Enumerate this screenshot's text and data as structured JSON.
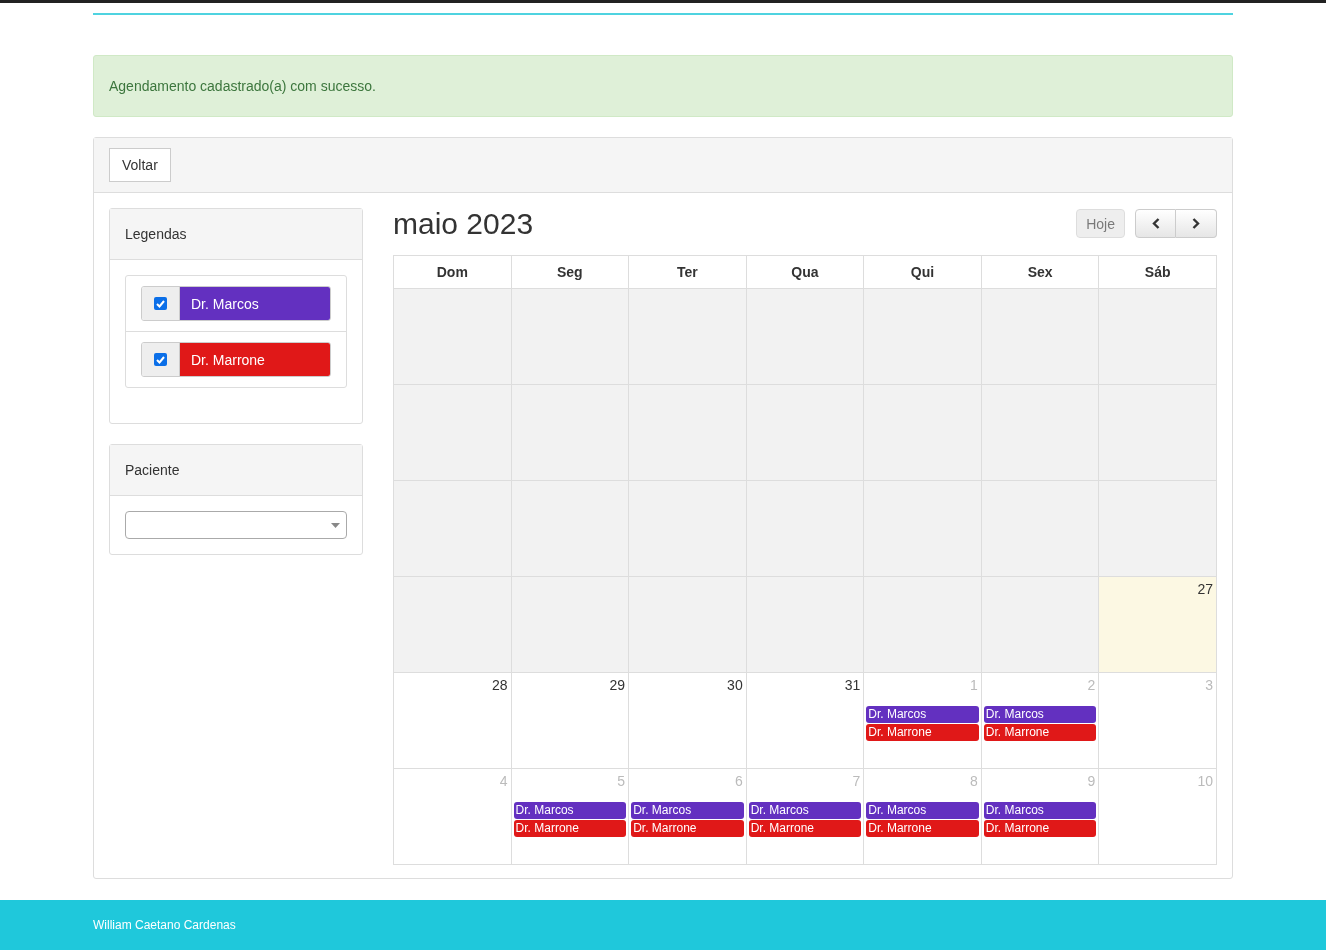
{
  "alert": {
    "message": "Agendamento cadastrado(a) com sucesso."
  },
  "toolbar": {
    "back_button": "Voltar"
  },
  "legend": {
    "title": "Legendas",
    "items": [
      {
        "label": "Dr. Marcos",
        "color": "#6330c0",
        "checked": true
      },
      {
        "label": "Dr. Marrone",
        "color": "#e01818",
        "checked": true
      }
    ]
  },
  "patient_filter": {
    "title": "Paciente"
  },
  "calendar": {
    "title": "maio 2023",
    "today_button": {
      "label": "Hoje",
      "disabled": true
    },
    "weekdays": [
      "Dom",
      "Seg",
      "Ter",
      "Qua",
      "Qui",
      "Sex",
      "Sáb"
    ],
    "weeks": [
      [
        {
          "kind": "blank"
        },
        {
          "kind": "blank"
        },
        {
          "kind": "blank"
        },
        {
          "kind": "blank"
        },
        {
          "kind": "blank"
        },
        {
          "kind": "blank"
        },
        {
          "kind": "blank"
        }
      ],
      [
        {
          "kind": "blank"
        },
        {
          "kind": "blank"
        },
        {
          "kind": "blank"
        },
        {
          "kind": "blank"
        },
        {
          "kind": "blank"
        },
        {
          "kind": "blank"
        },
        {
          "kind": "blank"
        }
      ],
      [
        {
          "kind": "blank"
        },
        {
          "kind": "blank"
        },
        {
          "kind": "blank"
        },
        {
          "kind": "blank"
        },
        {
          "kind": "blank"
        },
        {
          "kind": "blank"
        },
        {
          "kind": "blank"
        }
      ],
      [
        {
          "kind": "blank"
        },
        {
          "kind": "blank"
        },
        {
          "kind": "blank"
        },
        {
          "kind": "blank"
        },
        {
          "kind": "blank"
        },
        {
          "kind": "blank"
        },
        {
          "kind": "today",
          "day": "27"
        }
      ],
      [
        {
          "kind": "current",
          "day": "28"
        },
        {
          "kind": "current",
          "day": "29"
        },
        {
          "kind": "current",
          "day": "30"
        },
        {
          "kind": "current",
          "day": "31"
        },
        {
          "kind": "other",
          "day": "1",
          "events": [
            {
              "label": "Dr. Marcos",
              "color": "#6330c0"
            },
            {
              "label": "Dr. Marrone",
              "color": "#e01818"
            }
          ]
        },
        {
          "kind": "other",
          "day": "2",
          "events": [
            {
              "label": "Dr. Marcos",
              "color": "#6330c0"
            },
            {
              "label": "Dr. Marrone",
              "color": "#e01818"
            }
          ]
        },
        {
          "kind": "other",
          "day": "3"
        }
      ],
      [
        {
          "kind": "other",
          "day": "4"
        },
        {
          "kind": "other",
          "day": "5",
          "events": [
            {
              "label": "Dr. Marcos",
              "color": "#6330c0"
            },
            {
              "label": "Dr. Marrone",
              "color": "#e01818"
            }
          ]
        },
        {
          "kind": "other",
          "day": "6",
          "events": [
            {
              "label": "Dr. Marcos",
              "color": "#6330c0"
            },
            {
              "label": "Dr. Marrone",
              "color": "#e01818"
            }
          ]
        },
        {
          "kind": "other",
          "day": "7",
          "events": [
            {
              "label": "Dr. Marcos",
              "color": "#6330c0"
            },
            {
              "label": "Dr. Marrone",
              "color": "#e01818"
            }
          ]
        },
        {
          "kind": "other",
          "day": "8",
          "events": [
            {
              "label": "Dr. Marcos",
              "color": "#6330c0"
            },
            {
              "label": "Dr. Marrone",
              "color": "#e01818"
            }
          ]
        },
        {
          "kind": "other",
          "day": "9",
          "events": [
            {
              "label": "Dr. Marcos",
              "color": "#6330c0"
            },
            {
              "label": "Dr. Marrone",
              "color": "#e01818"
            }
          ]
        },
        {
          "kind": "other",
          "day": "10"
        }
      ]
    ]
  },
  "footer": {
    "text": "William Caetano Cardenas"
  }
}
